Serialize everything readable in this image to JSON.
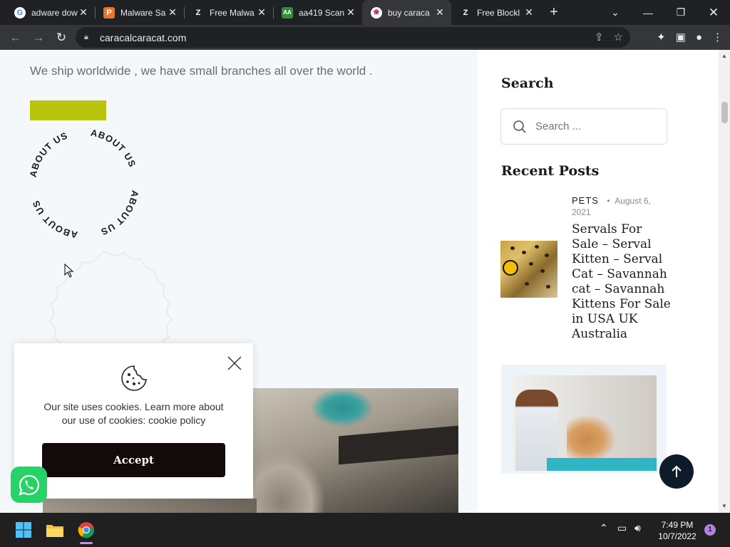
{
  "browser": {
    "tabs": [
      {
        "title": "adware dow",
        "favicon": "google-icon"
      },
      {
        "title": "Malware Sa",
        "favicon": "malware-site-icon"
      },
      {
        "title": "Free Malwa",
        "favicon": "z-icon"
      },
      {
        "title": "aa419 Scan",
        "favicon": "aa419-icon"
      },
      {
        "title": "buy caraca",
        "favicon": "paw-icon"
      },
      {
        "title": "Free Blockl",
        "favicon": "z-icon"
      }
    ],
    "active_tab_index": 4,
    "url": "caracalcaracat.com"
  },
  "main": {
    "ship_text": "We ship worldwide , we have small branches all over the world .",
    "circular_text": "ABOUT US",
    "accent_color": "#b9c40d"
  },
  "sidebar": {
    "search_title": "Search",
    "search_placeholder": "Search ...",
    "recent_title": "Recent Posts",
    "posts": [
      {
        "category": "PETS",
        "date": "August 6, 2021",
        "title": "Servals For Sale – Serval Kitten – Serval Cat – Savannah cat – Savannah Kittens For Sale in USA UK Australia"
      }
    ]
  },
  "cookie": {
    "message": "Our site uses cookies. Learn more about our use of cookies:",
    "policy_link": "cookie policy",
    "accept_label": "Accept"
  },
  "taskbar": {
    "time": "7:49 PM",
    "date": "10/7/2022",
    "notification_count": "1"
  }
}
